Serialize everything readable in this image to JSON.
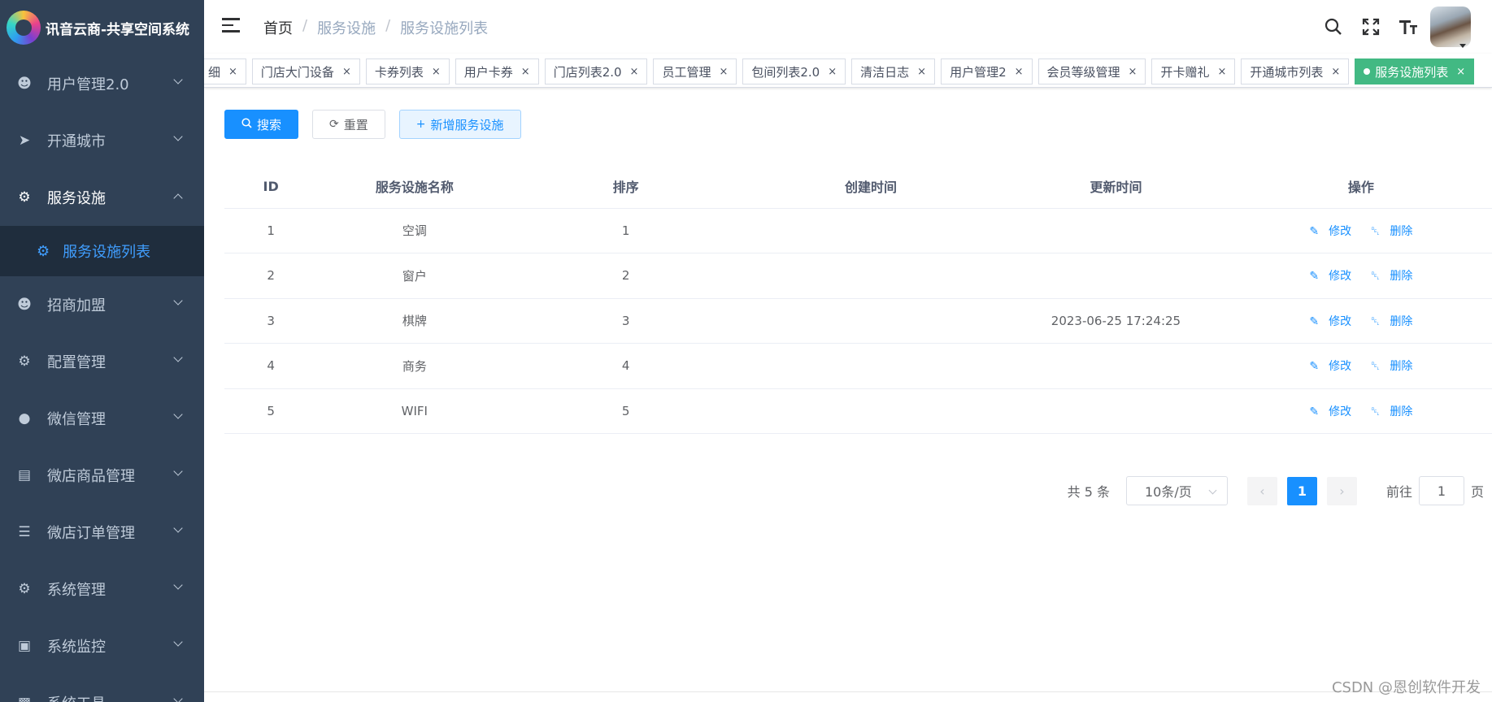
{
  "app": {
    "title": "讯音云商-共享空间系统"
  },
  "sidebar": {
    "items": [
      {
        "label": "用户管理2.0",
        "icon": "user-icon"
      },
      {
        "label": "开通城市",
        "icon": "send-icon"
      },
      {
        "label": "服务设施",
        "icon": "gear-icon",
        "open": true
      },
      {
        "label": "招商加盟",
        "icon": "user-icon"
      },
      {
        "label": "配置管理",
        "icon": "gear-icon"
      },
      {
        "label": "微信管理",
        "icon": "wechat-icon"
      },
      {
        "label": "微店商品管理",
        "icon": "bag-icon"
      },
      {
        "label": "微店订单管理",
        "icon": "document-icon"
      },
      {
        "label": "系统管理",
        "icon": "gear-icon"
      },
      {
        "label": "系统监控",
        "icon": "monitor-icon"
      },
      {
        "label": "系统工具",
        "icon": "toolbox-icon"
      }
    ],
    "sub_item": {
      "label": "服务设施列表",
      "icon": "gear-icon"
    }
  },
  "header": {
    "breadcrumb": {
      "home": "首页",
      "parent": "服务设施",
      "current": "服务设施列表"
    }
  },
  "tags": [
    {
      "label": "细"
    },
    {
      "label": "门店大门设备"
    },
    {
      "label": "卡券列表"
    },
    {
      "label": "用户卡券"
    },
    {
      "label": "门店列表2.0"
    },
    {
      "label": "员工管理"
    },
    {
      "label": "包间列表2.0"
    },
    {
      "label": "清洁日志"
    },
    {
      "label": "用户管理2"
    },
    {
      "label": "会员等级管理"
    },
    {
      "label": "开卡赠礼"
    },
    {
      "label": "开通城市列表"
    },
    {
      "label": "服务设施列表",
      "active": true
    }
  ],
  "toolbar": {
    "search_label": "搜索",
    "reset_label": "重置",
    "add_label": "新增服务设施"
  },
  "table": {
    "headers": [
      "ID",
      "服务设施名称",
      "排序",
      "创建时间",
      "更新时间",
      "操作"
    ],
    "rows": [
      [
        "1",
        "空调",
        "1",
        "",
        ""
      ],
      [
        "2",
        "窗户",
        "2",
        "",
        ""
      ],
      [
        "3",
        "棋牌",
        "3",
        "",
        "2023-06-25 17:24:25"
      ],
      [
        "4",
        "商务",
        "4",
        "",
        ""
      ],
      [
        "5",
        "WIFI",
        "5",
        "",
        ""
      ]
    ],
    "edit_label": "修改",
    "delete_label": "删除"
  },
  "pagination": {
    "total_text": "共 5 条",
    "page_size": "10条/页",
    "current_page": "1",
    "goto_prefix": "前往",
    "goto_value": "1",
    "goto_suffix": "页"
  },
  "watermark": "CSDN @恩创软件开发"
}
